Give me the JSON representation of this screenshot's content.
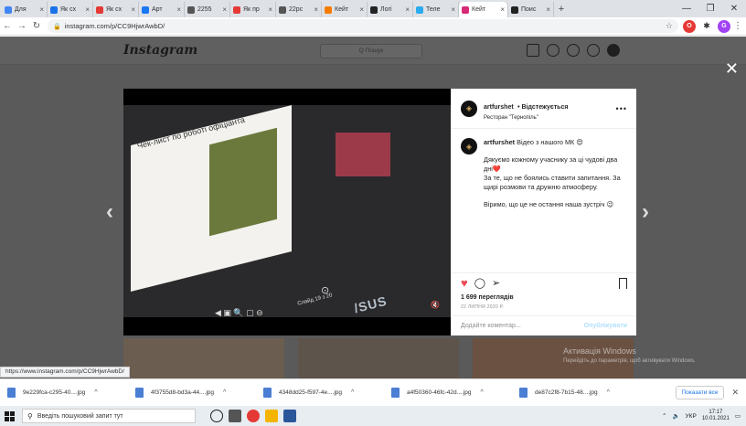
{
  "browser": {
    "tabs": [
      {
        "label": "Для",
        "fav": "#4285f4"
      },
      {
        "label": "Як сх",
        "fav": "#1a73e8"
      },
      {
        "label": "Як сх",
        "fav": "#e53935"
      },
      {
        "label": "Арт",
        "fav": "#1877f2"
      },
      {
        "label": "2255",
        "fav": "#555555"
      },
      {
        "label": "Як пр",
        "fav": "#e53935"
      },
      {
        "label": "22рс",
        "fav": "#555555"
      },
      {
        "label": "Кейт",
        "fav": "#f57c00"
      },
      {
        "label": "Логі",
        "fav": "#222222"
      },
      {
        "label": "Теле",
        "fav": "#2aabee"
      },
      {
        "label": "Кейт",
        "fav": "#d62976",
        "active": true
      },
      {
        "label": "Поис",
        "fav": "#222222"
      }
    ],
    "new_tab": "+",
    "url": "instagram.com/p/CC9HjwrAwbD/",
    "status_url": "https://www.instagram.com/p/CC9HjwrAwbD/"
  },
  "instagram": {
    "logo": "Instagram",
    "search_placeholder": "Q Пошук",
    "post": {
      "username": "artfurshet",
      "follow_label": "• Відстежується",
      "location": "Ресторан \"Тернопіль\"",
      "more": "•••",
      "caption_user": "artfurshet",
      "caption_intro": " Відео з нашого МК 😍",
      "caption_p1": "Дякуємо кожному учаснику за ці чудові два дні❤️",
      "caption_p2": "За те, що не боялись ставити запитання. За щирі розмови та дружню атмосферу.",
      "caption_p3": "Віримо, що це не остання наша зустріч 😉",
      "views": "1 699 переглядів",
      "date": "22 ЛИПНЯ 2020 Р.",
      "comment_placeholder": "Додайте коментар...",
      "post_label": "Опублікувати"
    },
    "video": {
      "slide_title": "Чек-лист по роботі офіціанта",
      "brand": "/SUS",
      "page_num": "Слайд 19 з 20"
    }
  },
  "overlay": {
    "activate_title": "Активація Windows",
    "activate_sub": "Перейдіть до параметрів, щоб активувати Windows."
  },
  "downloads": {
    "items": [
      "9e229fca-c295-40....jpg",
      "4f3755d8-bd3a-44....jpg",
      "4348dd25-f597-4e....jpg",
      "a4f50360-46fc-42d....jpg",
      "de87c2f8-7b15-48....jpg"
    ],
    "show_all": "Показати все"
  },
  "taskbar": {
    "search_placeholder": "Введіть пошуковий запит тут",
    "lang": "УКР",
    "time": "17:17",
    "date": "10.01.2021"
  }
}
